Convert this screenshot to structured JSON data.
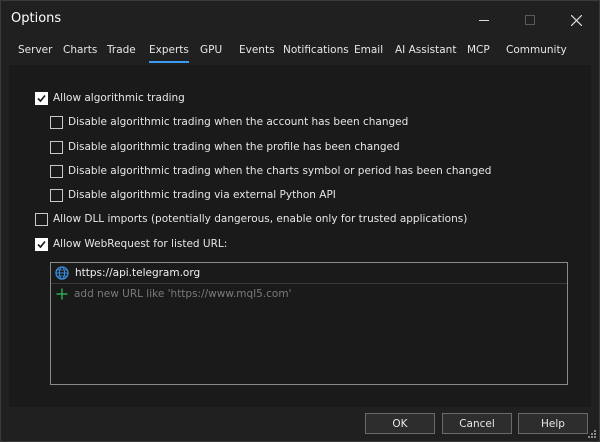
{
  "window": {
    "title": "Options"
  },
  "tabs": [
    {
      "label": "Server"
    },
    {
      "label": "Charts"
    },
    {
      "label": "Trade"
    },
    {
      "label": "Experts",
      "active": true
    },
    {
      "label": "GPU"
    },
    {
      "label": "Events"
    },
    {
      "label": "Notifications"
    },
    {
      "label": "Email"
    },
    {
      "label": "AI Assistant"
    },
    {
      "label": "MCP"
    },
    {
      "label": "Community"
    }
  ],
  "options": {
    "allow_algo": {
      "label": "Allow algorithmic trading",
      "checked": true
    },
    "disable_account": {
      "label": "Disable algorithmic trading when the account has been changed",
      "checked": false
    },
    "disable_profile": {
      "label": "Disable algorithmic trading when the profile has been changed",
      "checked": false
    },
    "disable_symbol": {
      "label": "Disable algorithmic trading when the charts symbol or period has been changed",
      "checked": false
    },
    "disable_python": {
      "label": "Disable algorithmic trading via external Python API",
      "checked": false
    },
    "allow_dll": {
      "label": "Allow DLL imports (potentially dangerous, enable only for trusted applications)",
      "checked": false
    },
    "allow_webrequest": {
      "label": "Allow WebRequest for listed URL:",
      "checked": true
    }
  },
  "url_list": {
    "urls": [
      "https://api.telegram.org"
    ],
    "add_placeholder": "add new URL like 'https://www.mql5.com'"
  },
  "buttons": {
    "ok": "OK",
    "cancel": "Cancel",
    "help": "Help"
  },
  "colors": {
    "accent": "#3b9cf2",
    "add_icon": "#2fae5a",
    "globe_icon": "#3a8fe0"
  }
}
